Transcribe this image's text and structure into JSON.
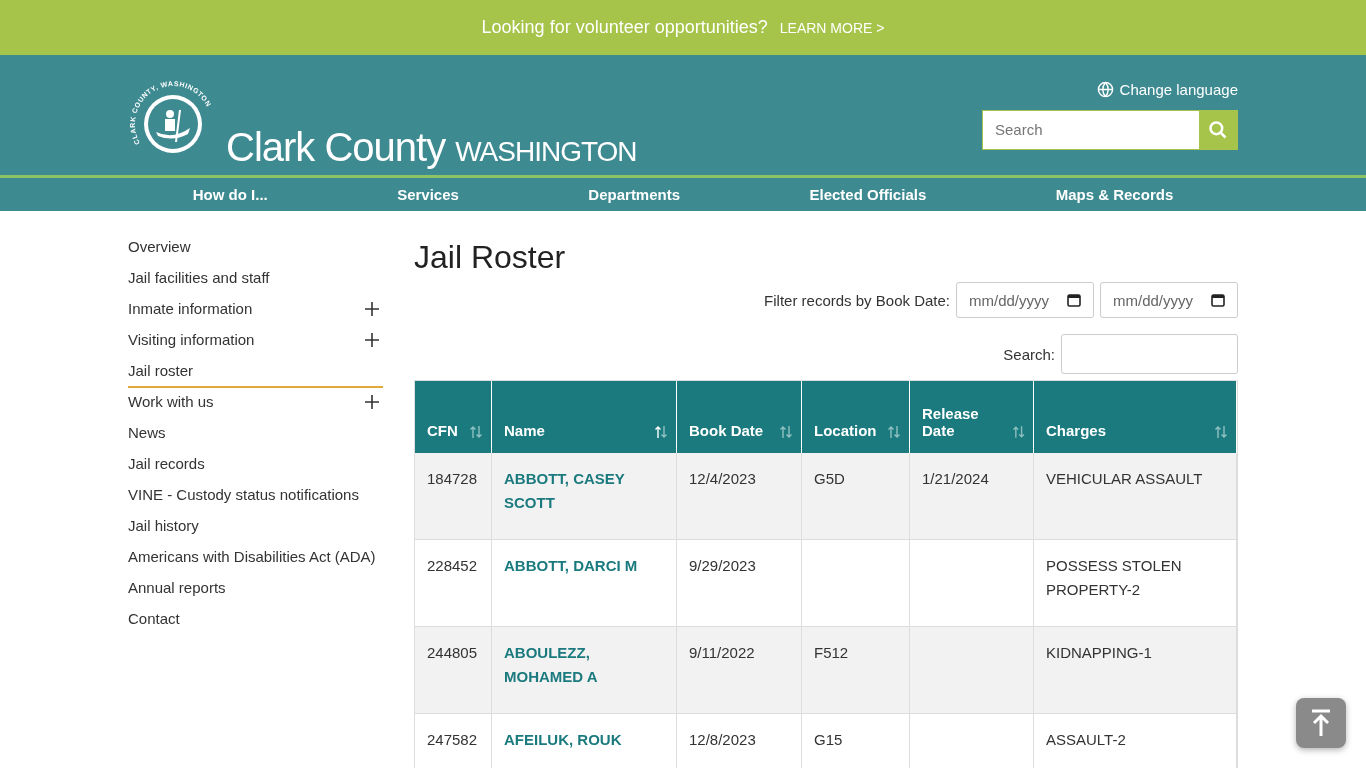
{
  "banner": {
    "text": "Looking for volunteer opportunities?",
    "link": "LEARN MORE >"
  },
  "header": {
    "seal_text": "CLARK COUNTY, WASHINGTON",
    "title": "Clark County",
    "subtitle": "WASHINGTON",
    "language": "Change language",
    "search": {
      "placeholder": "Search"
    }
  },
  "nav": [
    "How do I...",
    "Services",
    "Departments",
    "Elected Officials",
    "Maps & Records"
  ],
  "sidebar": [
    {
      "label": "Overview",
      "expandable": false,
      "selected": false
    },
    {
      "label": "Jail facilities and staff",
      "expandable": false,
      "selected": false
    },
    {
      "label": "Inmate information",
      "expandable": true,
      "selected": false
    },
    {
      "label": "Visiting information",
      "expandable": true,
      "selected": false
    },
    {
      "label": "Jail roster",
      "expandable": false,
      "selected": true
    },
    {
      "label": "Work with us",
      "expandable": true,
      "selected": false
    },
    {
      "label": "News",
      "expandable": false,
      "selected": false
    },
    {
      "label": "Jail records",
      "expandable": false,
      "selected": false
    },
    {
      "label": "VINE - Custody status notifications",
      "expandable": false,
      "selected": false
    },
    {
      "label": "Jail history",
      "expandable": false,
      "selected": false
    },
    {
      "label": "Americans with Disabilities Act (ADA)",
      "expandable": false,
      "selected": false
    },
    {
      "label": "Annual reports",
      "expandable": false,
      "selected": false
    },
    {
      "label": "Contact",
      "expandable": false,
      "selected": false
    }
  ],
  "page_title": "Jail Roster",
  "filter": {
    "label": "Filter records by Book Date:",
    "from_placeholder": "mm/dd/yyyy",
    "to_placeholder": "mm/dd/yyyy"
  },
  "search_label": "Search:",
  "table": {
    "columns": [
      {
        "label": "CFN",
        "sorted": false
      },
      {
        "label": "Name",
        "sorted": true
      },
      {
        "label": "Book Date",
        "sorted": false
      },
      {
        "label": "Location",
        "sorted": false
      },
      {
        "label": "Release Date",
        "sorted": false
      },
      {
        "label": "Charges",
        "sorted": false
      }
    ],
    "rows": [
      [
        "184728",
        "ABBOTT, CASEY SCOTT",
        "12/4/2023",
        "G5D",
        "1/21/2024",
        "VEHICULAR ASSAULT"
      ],
      [
        "228452",
        "ABBOTT, DARCI M",
        "9/29/2023",
        "",
        "",
        "POSSESS STOLEN PROPERTY-2"
      ],
      [
        "244805",
        "ABOULEZZ, MOHAMED A",
        "9/11/2022",
        "F512",
        "",
        "KIDNAPPING-1"
      ],
      [
        "247582",
        "AFEILUK, ROUK",
        "12/8/2023",
        "G15",
        "",
        "ASSAULT-2"
      ]
    ]
  }
}
